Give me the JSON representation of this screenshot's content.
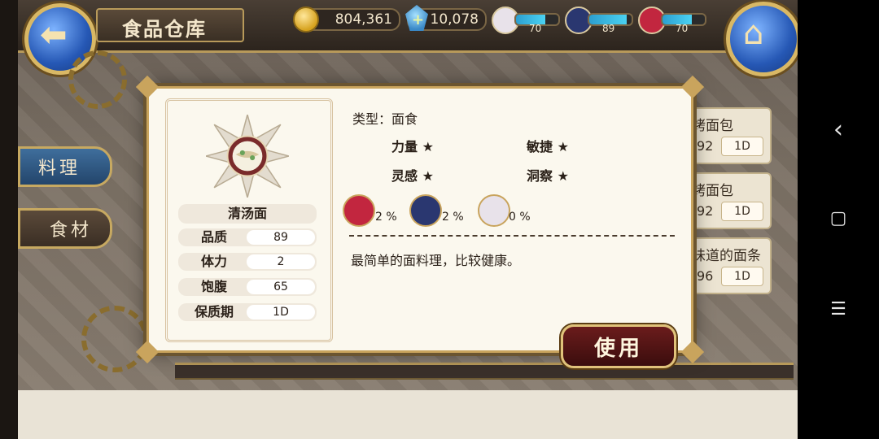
{
  "header": {
    "title": "食品仓库"
  },
  "resources": {
    "gold": "804,361",
    "gems": "10,078"
  },
  "stamina": [
    {
      "name": "silver-hair-character",
      "value": "70",
      "level": 0.7,
      "color": "#e8e2ea"
    },
    {
      "name": "blue-hair-character",
      "value": "89",
      "level": 0.89,
      "color": "#2a3770"
    },
    {
      "name": "red-hair-character",
      "value": "70",
      "level": 0.7,
      "color": "#c2263f"
    }
  ],
  "side_tabs": [
    {
      "label": "料理"
    },
    {
      "label": "食材"
    }
  ],
  "list": [
    {
      "name": "烤面包",
      "quality": "92",
      "shelf": "1D"
    },
    {
      "name": "烤面包",
      "quality": "92",
      "shelf": "1D"
    },
    {
      "name": "味道的面条",
      "quality": "96",
      "shelf": "1D"
    }
  ],
  "modal": {
    "item_name": "清汤面",
    "stats": [
      {
        "label": "品质",
        "value": "89"
      },
      {
        "label": "体力",
        "value": "2"
      },
      {
        "label": "饱腹",
        "value": "65"
      },
      {
        "label": "保质期",
        "value": "1D"
      }
    ],
    "type": "类型：面食",
    "attributes": [
      {
        "label": "力量",
        "stars": "★"
      },
      {
        "label": "敏捷",
        "stars": "★"
      },
      {
        "label": "灵感",
        "stars": "★"
      },
      {
        "label": "洞察",
        "stars": "★"
      }
    ],
    "characters": [
      {
        "icon": "red-hair-character-icon",
        "pct": "2 %",
        "color": "#c2263f"
      },
      {
        "icon": "blue-hair-character-icon",
        "pct": "2 %",
        "color": "#2a3770"
      },
      {
        "icon": "silver-hair-character-icon",
        "pct": "0 %",
        "color": "#e8e2ea"
      }
    ],
    "description": "最简单的面料理，比较健康。",
    "use_label": "使用"
  },
  "icons": {
    "back": "back-arrow-icon",
    "home": "home-icon"
  },
  "android_nav": {
    "back": "‹",
    "home": "▢",
    "menu": "☰"
  }
}
